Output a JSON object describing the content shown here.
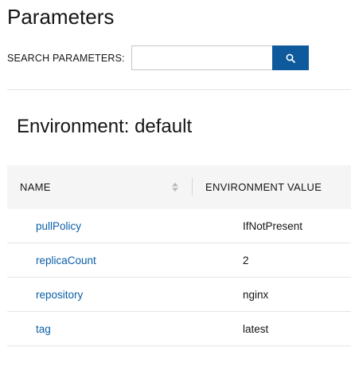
{
  "page": {
    "title": "Parameters"
  },
  "search": {
    "label": "SEARCH PARAMETERS:",
    "value": "",
    "placeholder": ""
  },
  "environment": {
    "title": "Environment: default"
  },
  "table": {
    "columns": [
      "NAME",
      "ENVIRONMENT VALUE"
    ],
    "rows": [
      {
        "name": "pullPolicy",
        "value": "IfNotPresent"
      },
      {
        "name": "replicaCount",
        "value": "2"
      },
      {
        "name": "repository",
        "value": "nginx"
      },
      {
        "name": "tag",
        "value": "latest"
      }
    ]
  },
  "icons": {
    "search_button": "search-icon",
    "sort": "sort-icon"
  },
  "colors": {
    "accent": "#0f5a9c",
    "link": "#0b5ea8",
    "header_bg": "#f5f5f5"
  }
}
